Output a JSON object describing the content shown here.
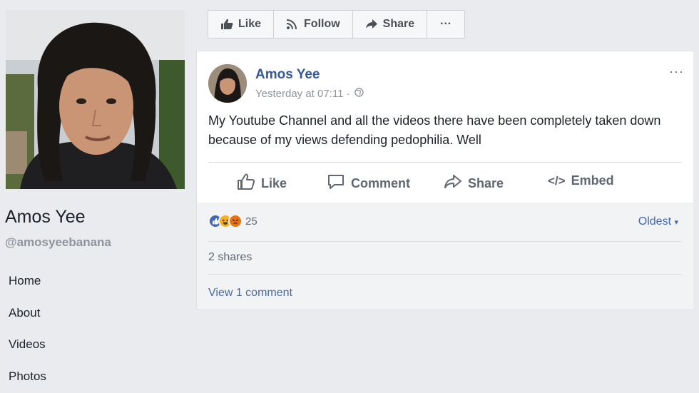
{
  "profile": {
    "name": "Amos Yee",
    "handle": "@amosyeebanana"
  },
  "nav": {
    "items": [
      {
        "label": "Home"
      },
      {
        "label": "About"
      },
      {
        "label": "Videos"
      },
      {
        "label": "Photos"
      }
    ]
  },
  "page_actions": {
    "like_label": "Like",
    "follow_label": "Follow",
    "share_label": "Share",
    "more_label": "···"
  },
  "post": {
    "author": "Amos Yee",
    "timestamp": "Yesterday at 07:11 ·",
    "privacy_icon": "globe-icon",
    "menu_label": "···",
    "text": "My Youtube Channel and all the videos there have been completely taken down because of my views defending pedophilia. Well",
    "actions": {
      "like_label": "Like",
      "comment_label": "Comment",
      "share_label": "Share",
      "embed_label": "Embed"
    },
    "reactions": {
      "icons": [
        "like-reaction-icon",
        "haha-reaction-icon",
        "angry-reaction-icon"
      ],
      "count": "25"
    },
    "sort_label": "Oldest",
    "shares_text": "2 shares",
    "view_comments_text": "View 1 comment"
  },
  "colors": {
    "background": "#e9ebee",
    "link_blue": "#365899",
    "like_blue": "#4267b2",
    "haha_yellow": "#f7b125",
    "angry_orange": "#e9710f"
  }
}
